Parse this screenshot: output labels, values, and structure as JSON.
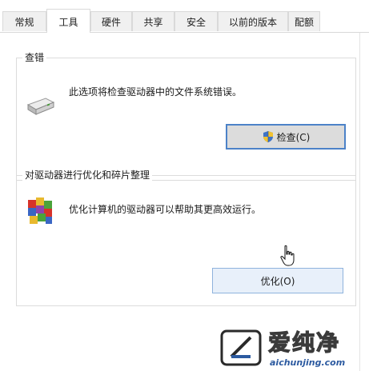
{
  "tabs": [
    {
      "label": "常规"
    },
    {
      "label": "工具"
    },
    {
      "label": "硬件"
    },
    {
      "label": "共享"
    },
    {
      "label": "安全"
    },
    {
      "label": "以前的版本"
    },
    {
      "label": "配额"
    }
  ],
  "active_tab": "工具",
  "check_group": {
    "title": "查错",
    "description": "此选项将检查驱动器中的文件系统错误。",
    "button_label": "检查(C)"
  },
  "optimize_group": {
    "title": "对驱动器进行优化和碎片整理",
    "description": "优化计算机的驱动器可以帮助其更高效运行。",
    "button_label": "优化(O)"
  },
  "watermark": {
    "name": "爱纯净",
    "url": "aichunjing.com"
  },
  "colors": {
    "focus_border": "#4c82c8",
    "watermark_blue": "#2c5aa0"
  },
  "icons": [
    "drive-icon",
    "shield-icon",
    "defrag-icon",
    "cursor-icon",
    "watermark-logo-icon"
  ]
}
